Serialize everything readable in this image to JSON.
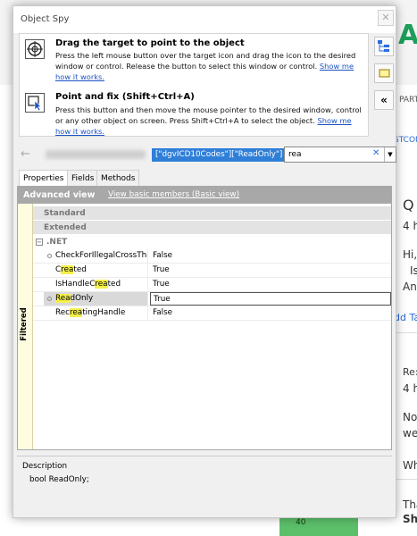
{
  "window": {
    "title": "Object Spy",
    "close_glyph": "✕"
  },
  "instructions": {
    "drag": {
      "title": "Drag the target to point to the object",
      "desc": "Press the left mouse button over the target icon and drag the icon to the desired window or control. Release the button to select this window or control.",
      "link": "Show me how it works.",
      "icon": "crosshair-target-icon"
    },
    "point": {
      "title": "Point and fix (Shift+Ctrl+A)",
      "desc": "Press this button and then move the mouse pointer to the desired window, control or any other object on screen. Press Shift+Ctrl+A to select the object.",
      "link": "Show me how it works.",
      "icon": "pointer-select-icon"
    }
  },
  "address": {
    "back_glyph": "←",
    "crumb": "[\"dgvICD10Codes\"][\"ReadOnly\"]",
    "search_value": "rea",
    "clear_glyph": "✕",
    "dropdown_glyph": "▼"
  },
  "tabs": [
    "Properties",
    "Fields",
    "Methods"
  ],
  "panel": {
    "advanced_title": "Advanced view",
    "basic_link": "View basic members (Basic view)",
    "filtered_label": "Filtered",
    "categories": {
      "standard": "Standard",
      "extended": "Extended",
      "net": ".NET",
      "net_toggle": "−"
    },
    "rows": [
      {
        "pre": "CheckForIllegalCrossThr",
        "hl": "e",
        "post": "",
        "value": "False"
      },
      {
        "pre": "C",
        "hl": "rea",
        "post": "ted",
        "value": "True"
      },
      {
        "pre": "IsHandleC",
        "hl": "rea",
        "post": "ted",
        "value": "True"
      },
      {
        "pre": "",
        "hl": "Rea",
        "post": "dOnly",
        "value": "True"
      },
      {
        "pre": "Rec",
        "hl": "rea",
        "post": "tingHandle",
        "value": "False"
      }
    ]
  },
  "description": {
    "title": "Description",
    "text": "bool ReadOnly;"
  },
  "background": {
    "brand": "AI",
    "brand_color": "#1e9e5a",
    "part_text": "PART",
    "stcom_text": "STCOM",
    "q_text": "Q",
    "four_h": "4 h",
    "hi_text": "Hi,",
    "is_text": "Is",
    "an_text": "An",
    "add_ta": "dd Ta",
    "re_text": "Re:",
    "four_h2": "4 h",
    "no_text": "No",
    "we_text": "we",
    "wh_text": "Wh",
    "tha_text": "Tha",
    "sh_text": "Sh",
    "badge_num": "40"
  }
}
